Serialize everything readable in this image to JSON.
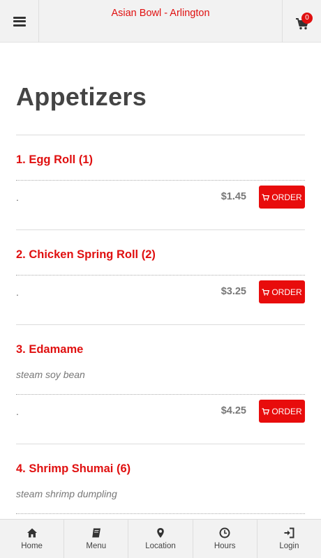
{
  "header": {
    "title": "Asian Bowl - Arlington",
    "cart_count": "0"
  },
  "section": {
    "title": "Appetizers"
  },
  "items": [
    {
      "name": "1. Egg Roll (1)",
      "description": "",
      "size": ".",
      "price": "$1.45",
      "order_label": "ORDER"
    },
    {
      "name": "2. Chicken Spring Roll (2)",
      "description": "",
      "size": ".",
      "price": "$3.25",
      "order_label": "ORDER"
    },
    {
      "name": "3. Edamame",
      "description": "steam soy bean",
      "size": ".",
      "price": "$4.25",
      "order_label": "ORDER"
    },
    {
      "name": "4. Shrimp Shumai (6)",
      "description": "steam shrimp dumpling",
      "size": "",
      "price": "",
      "order_label": ""
    }
  ],
  "bottom_nav": [
    {
      "label": "Home",
      "icon": "home-icon"
    },
    {
      "label": "Menu",
      "icon": "book-icon"
    },
    {
      "label": "Location",
      "icon": "map-pin-icon"
    },
    {
      "label": "Hours",
      "icon": "clock-icon"
    },
    {
      "label": "Login",
      "icon": "login-icon"
    }
  ],
  "colors": {
    "accent": "#e01010",
    "order_button": "#e80c0c",
    "bar_background": "#f2f2f2"
  }
}
